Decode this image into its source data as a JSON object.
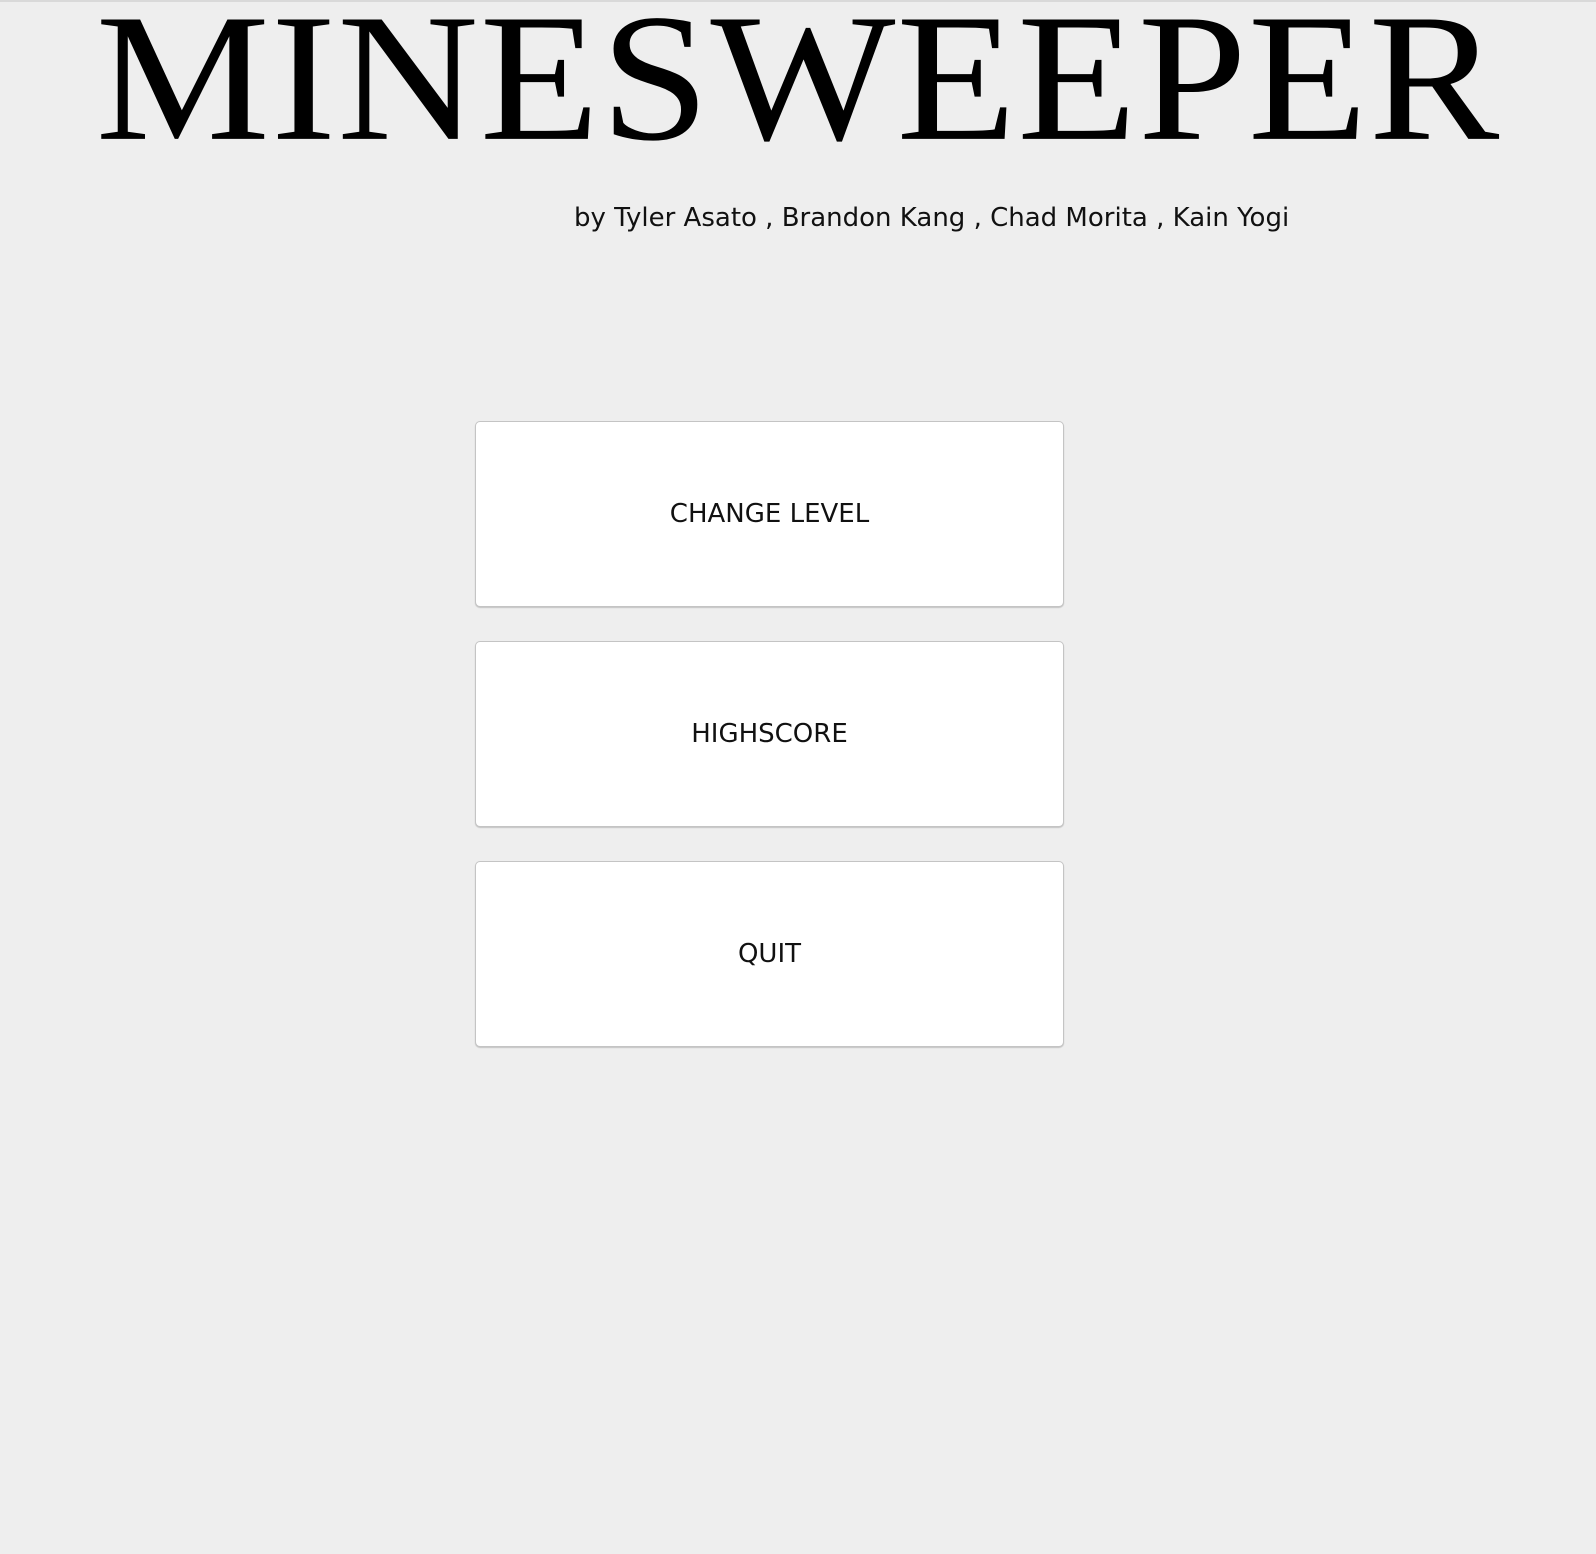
{
  "app": {
    "title": "MINESWEEPER",
    "byline": "by Tyler Asato , Brandon Kang , Chad Morita , Kain Yogi"
  },
  "menu": {
    "buttons": [
      {
        "label": "CHANGE LEVEL"
      },
      {
        "label": "HIGHSCORE"
      },
      {
        "label": "QUIT"
      }
    ]
  },
  "colors": {
    "background": "#eeeeee",
    "button_face": "#ffffff",
    "text": "#000000"
  }
}
